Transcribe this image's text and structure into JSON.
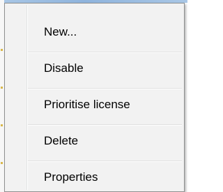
{
  "context_menu": {
    "items": [
      {
        "label": "New..."
      },
      {
        "label": "Disable"
      },
      {
        "label": "Prioritise license"
      },
      {
        "label": "Delete"
      },
      {
        "label": "Properties"
      }
    ]
  }
}
